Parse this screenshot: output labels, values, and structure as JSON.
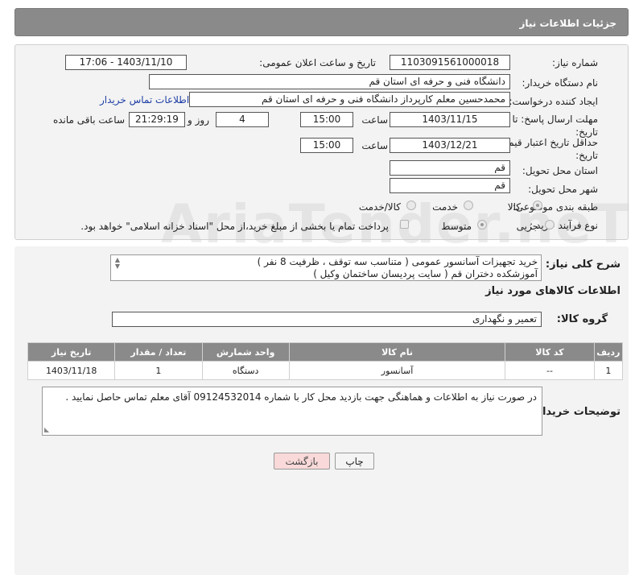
{
  "header": {
    "title": "جزئیات اطلاعات نیاز"
  },
  "form": {
    "need_number_label": "شماره نیاز:",
    "need_number": "1103091561000018",
    "announce_label": "تاریخ و ساعت اعلان عمومی:",
    "announce_value": "1403/11/10 - 17:06",
    "buyer_org_label": "نام دستگاه خریدار:",
    "buyer_org": "دانشگاه فنی و حرفه ای استان قم",
    "creator_label": "ایجاد کننده درخواست:",
    "creator": "محمدحسین معلم کارپرداز دانشگاه فنی و حرفه ای استان قم",
    "contact_link": "اطلاعات تماس خریدار",
    "deadline_label": "مهلت ارسال پاسخ: تا",
    "deadline_label2": "تاریخ:",
    "deadline_date": "1403/11/15",
    "time_label": "ساعت",
    "deadline_time": "15:00",
    "days_value": "4",
    "days_label": "روز و",
    "remaining_time": "21:29:19",
    "remaining_label": "ساعت باقی مانده",
    "validity_label": "حداقل تاریخ اعتبار قیمت: تا",
    "validity_label2": "تاریخ:",
    "validity_date": "1403/12/21",
    "validity_time": "15:00",
    "province_label": "استان محل تحویل:",
    "province": "قم",
    "city_label": "شهر محل تحویل:",
    "city": "قم",
    "category_label": "طبقه بندی موضوعی:",
    "category_options": [
      "کالا",
      "خدمت",
      "کالا/خدمت"
    ],
    "process_label": "نوع فرآیند خرید :",
    "process_options": [
      "جزیی",
      "متوسط"
    ],
    "payment_note": "پرداخت تمام یا بخشی از مبلغ خرید،از محل \"اسناد خزانه اسلامی\" خواهد بود."
  },
  "description": {
    "label": "شرح کلی نیاز:",
    "line1": "خرید تجهیزات آسانسور عمومی ( متناسب سه توقف ، ظرفیت 8 نفر )",
    "line2": "آموزشکده دختران قم ( سایت پردیسان ساختمان وکیل )"
  },
  "goods": {
    "section_title": "اطلاعات کالاهای مورد نیاز",
    "group_label": "گروه کالا:",
    "group_value": "تعمیر و نگهداری",
    "columns": [
      "ردیف",
      "کد کالا",
      "نام کالا",
      "واحد شمارش",
      "تعداد / مقدار",
      "تاریخ نیاز"
    ],
    "rows": [
      {
        "row": "1",
        "code": "--",
        "name": "آسانسور",
        "unit": "دستگاه",
        "qty": "1",
        "date": "1403/11/18"
      }
    ]
  },
  "buyer_notes": {
    "label": "توضیحات خریدار:",
    "text": "در صورت نیاز به اطلاعات و هماهنگی جهت بازدید محل کار با شماره 09124532014 آقای معلم تماس حاصل نمایید ."
  },
  "buttons": {
    "print": "چاپ",
    "back": "بازگشت"
  },
  "watermark": "AriaTender.neT",
  "colors": {
    "header_bg": "#8a8a8a",
    "link": "#1f3fa6",
    "back_button_bg": "#f9d9d9"
  }
}
